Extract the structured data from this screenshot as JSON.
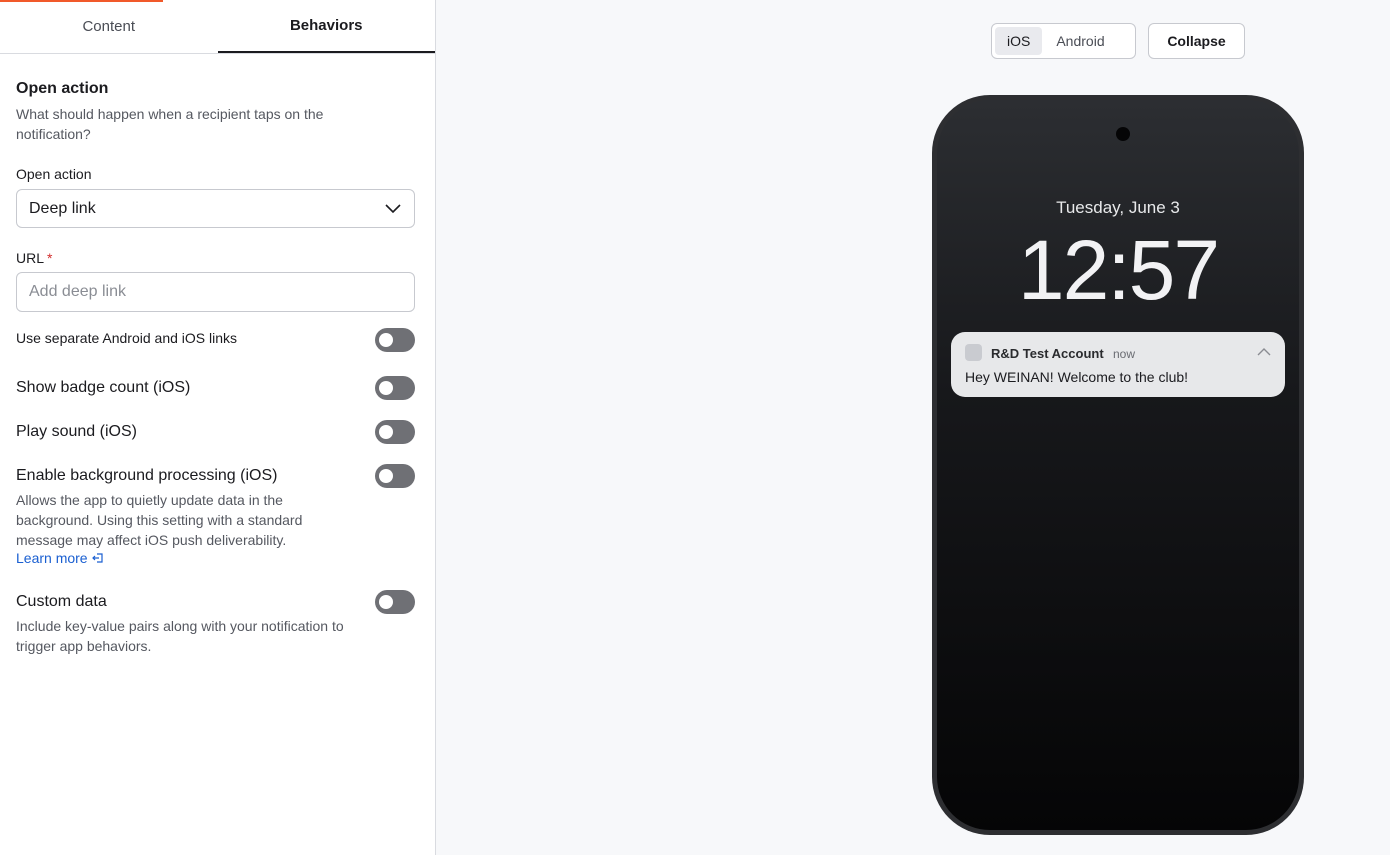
{
  "tabs": {
    "content": "Content",
    "behaviors": "Behaviors"
  },
  "open_action_section": {
    "title": "Open action",
    "description": "What should happen when a recipient taps on the notification?",
    "field_label": "Open action",
    "selected_value": "Deep link"
  },
  "url_field": {
    "label": "URL",
    "required_marker": "*",
    "placeholder": "Add deep link",
    "value": ""
  },
  "toggles": {
    "separate_links": {
      "label": "Use separate Android and iOS links",
      "on": false
    },
    "badge_count": {
      "label": "Show badge count (iOS)",
      "on": false
    },
    "play_sound": {
      "label": "Play sound (iOS)",
      "on": false
    },
    "background_processing": {
      "label": "Enable background processing (iOS)",
      "description": "Allows the app to quietly update data in the background. Using this setting with a standard message may affect iOS push deliverability.",
      "link": "Learn more",
      "on": false
    },
    "custom_data": {
      "label": "Custom data",
      "description": "Include key-value pairs along with your notification to trigger app behaviors.",
      "on": false
    }
  },
  "preview": {
    "platforms": [
      "iOS",
      "Android"
    ],
    "selected_platform": "iOS",
    "collapse_label": "Collapse",
    "date": "Tuesday, June 3",
    "time": "12:57",
    "notification": {
      "app_name": "R&D Test Account",
      "timestamp": "now",
      "message": "Hey WEINAN! Welcome to the club!"
    }
  },
  "colors": {
    "accent_progress": "#f1592a",
    "link": "#1a5fd1",
    "required": "#d12b2b",
    "toggle_off": "#6f7075"
  }
}
